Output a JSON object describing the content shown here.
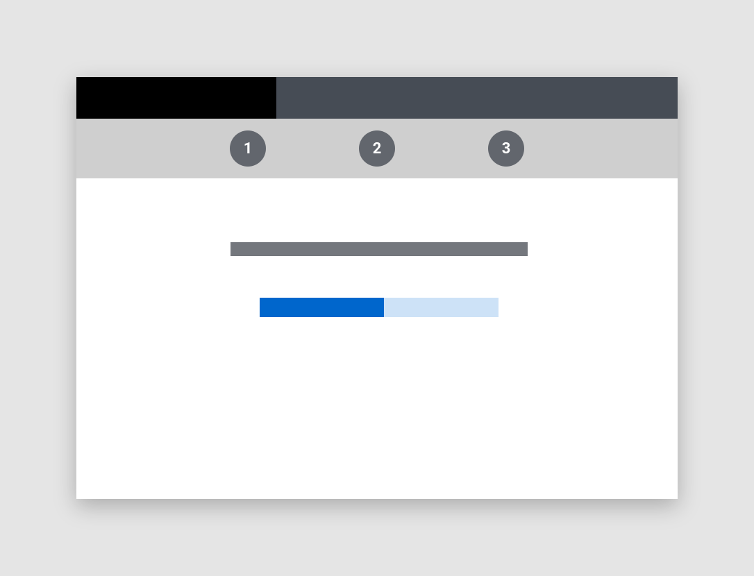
{
  "stepper": {
    "steps": [
      {
        "label": "1"
      },
      {
        "label": "2"
      },
      {
        "label": "3"
      }
    ]
  },
  "progress": {
    "percent": 52
  },
  "colors": {
    "progress_fill": "#0066cc",
    "progress_track": "#cde2f7",
    "step_circle": "#62666d",
    "top_bar_dark": "#000000",
    "top_bar_grey": "#464c55"
  }
}
